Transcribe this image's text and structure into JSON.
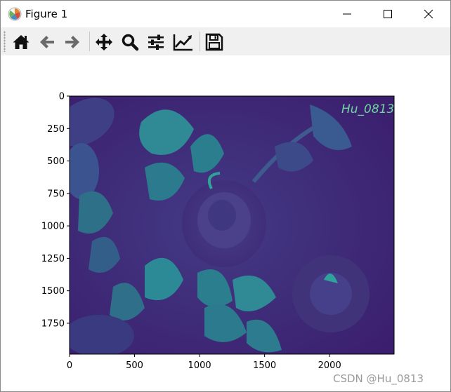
{
  "window": {
    "title": "Figure 1",
    "minimize_glyph": "minimize-icon",
    "maximize_glyph": "maximize-icon",
    "close_glyph": "close-icon"
  },
  "toolbar": {
    "tools": [
      {
        "name": "home-icon"
      },
      {
        "name": "back-arrow-icon"
      },
      {
        "name": "forward-arrow-icon"
      },
      {
        "name": "pan-icon"
      },
      {
        "name": "zoom-icon"
      },
      {
        "name": "configure-subplots-icon"
      },
      {
        "name": "edit-axes-icon"
      },
      {
        "name": "save-icon"
      }
    ]
  },
  "plot": {
    "x_ticks": [
      "0",
      "500",
      "1000",
      "1500",
      "2000"
    ],
    "y_ticks": [
      "0",
      "250",
      "500",
      "750",
      "1000",
      "1250",
      "1500",
      "1750"
    ],
    "image_watermark": "Hu_0813",
    "colors": {
      "background_dark": "#3b1a6b",
      "mid": "#3a4f8c",
      "leaf": "#2b7e8e",
      "leaf_light": "#2fa39a",
      "accent_green": "#6fd6a0"
    }
  },
  "footer": {
    "watermark": "CSDN @Hu_0813"
  }
}
